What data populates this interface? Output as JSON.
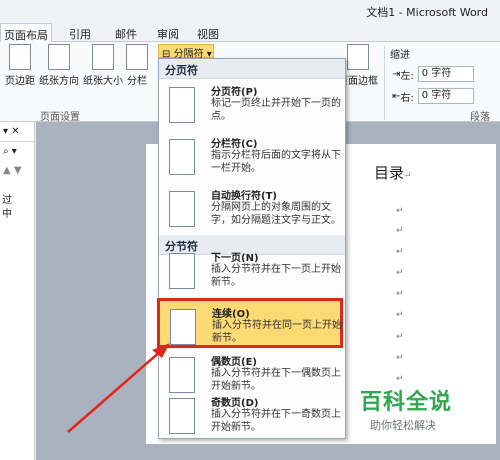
{
  "window": {
    "title": "文档1 - Microsoft Word"
  },
  "tabs": [
    "页面布局",
    "引用",
    "邮件",
    "审阅",
    "视图"
  ],
  "ribbon": {
    "buttons": [
      "页边距",
      "纸张方向",
      "纸张大小",
      "分栏"
    ],
    "group_label": "页面设置",
    "separator_button": "分隔符",
    "page_border": "页面边框",
    "indent_label": "缩进",
    "indent_left": {
      "label": "左:",
      "value": "0 字符"
    },
    "indent_right": {
      "label": "右:",
      "value": "0 字符"
    },
    "paragraph_label": "段落"
  },
  "left_panel": {
    "text": "过\n中"
  },
  "document": {
    "title": "目录",
    "para_mark": "↵"
  },
  "menu": {
    "section1": "分页符",
    "section2": "分节符",
    "items": [
      {
        "title": "分页符(P)",
        "desc": "标记一页终止并开始下一页的点。"
      },
      {
        "title": "分栏符(C)",
        "desc": "指示分栏符后面的文字将从下一栏开始。"
      },
      {
        "title": "自动换行符(T)",
        "desc": "分隔网页上的对象周围的文字，如分隔题注文字与正文。"
      },
      {
        "title": "下一页(N)",
        "desc": "插入分节符并在下一页上开始新节。"
      },
      {
        "title": "连续(O)",
        "desc": "插入分节符并在同一页上开始新节。"
      },
      {
        "title": "偶数页(E)",
        "desc": "插入分节符并在下一偶数页上开始新节。"
      },
      {
        "title": "奇数页(D)",
        "desc": "插入分节符并在下一奇数页上开始新节。"
      }
    ]
  },
  "watermark": {
    "brand": "百科全说",
    "tagline": "助你轻松解决"
  },
  "colors": {
    "highlight": "#fbd973",
    "arrow": "#e1261c",
    "brand_green": "#2fa84f"
  }
}
